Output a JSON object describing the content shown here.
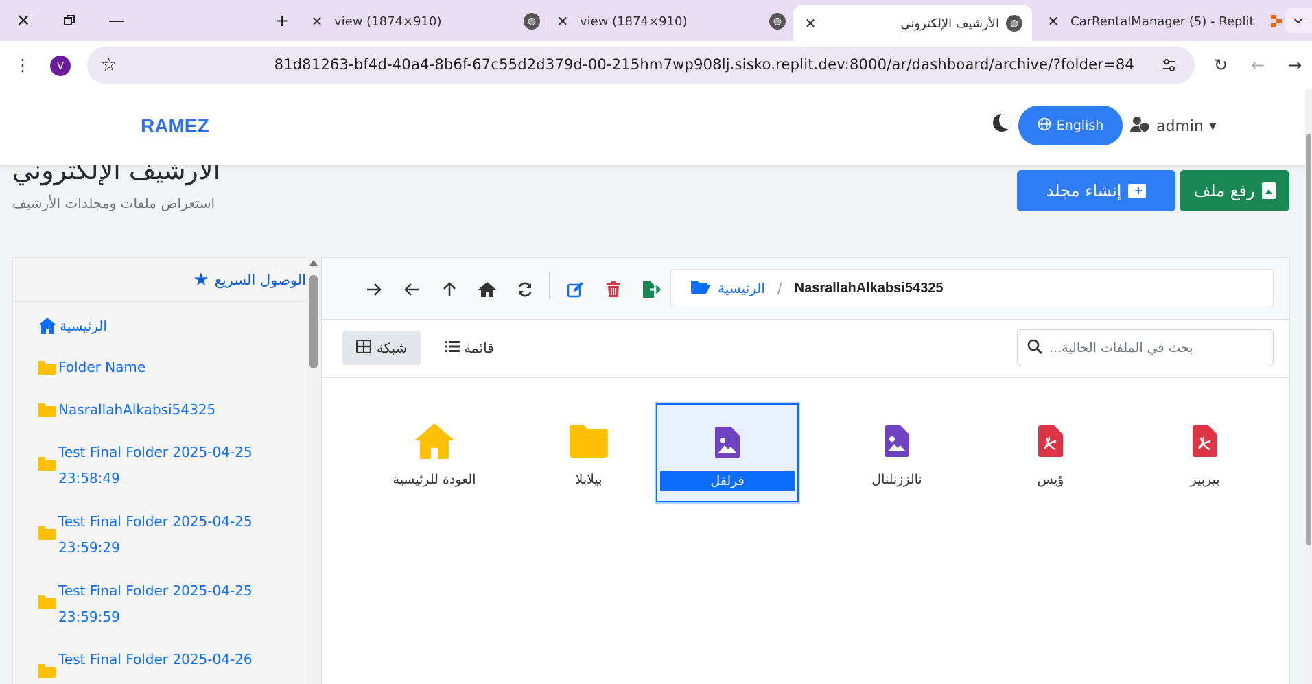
{
  "browser": {
    "tabs": [
      {
        "title": "view (1874×910)"
      },
      {
        "title": "view (1874×910)"
      },
      {
        "title": "الأرشيف الإلكتروني"
      },
      {
        "title": "CarRentalManager (5) - Replit"
      }
    ],
    "avatar_letter": "V",
    "url": "81d81263-bf4d-40a4-8b6f-67c55d2d379d-00-215hm7wp908lj.sisko.replit.dev:8000/ar/dashboard/archive/?folder=84"
  },
  "navbar": {
    "brand": "RAMEZ",
    "lang_label": "English",
    "user_label": "admin"
  },
  "header": {
    "title": "الأرشيف الإلكتروني",
    "subtitle": "استعراض ملفات ومجلدات الأرشيف",
    "upload_label": "رفع ملف",
    "create_folder_label": "إنشاء مجلد"
  },
  "sidebar": {
    "title": "الوصول السريع",
    "items": [
      {
        "label": "الرئيسية"
      },
      {
        "label": "Folder Name"
      },
      {
        "label": "NasrallahAlkabsi54325"
      },
      {
        "label": "Test Final Folder 2025-04-25",
        "label2": "23:58:49"
      },
      {
        "label": "Test Final Folder 2025-04-25",
        "label2": "23:59:29"
      },
      {
        "label": "Test Final Folder 2025-04-25",
        "label2": "23:59:59"
      },
      {
        "label": "Test Final Folder 2025-04-26"
      }
    ]
  },
  "breadcrumb": {
    "home": "الرئيسية",
    "current": "NasrallahAlkabsi54325"
  },
  "view": {
    "grid_label": "شبكة",
    "list_label": "قائمة",
    "search_placeholder": "بحث في الملفات الحالية..."
  },
  "items": [
    {
      "name": "العودة للرئيسية",
      "icon": "home-icon"
    },
    {
      "name": "بيلابلا",
      "icon": "folder-icon"
    },
    {
      "name": "قرلقل",
      "icon": "image-file-icon"
    },
    {
      "name": "نالززنلنال",
      "icon": "image-file-icon"
    },
    {
      "name": "ؤيس",
      "icon": "pdf-file-icon"
    },
    {
      "name": "بيربير",
      "icon": "pdf-file-icon"
    }
  ],
  "colors": {
    "primary": "#2f7df6",
    "success": "#198754",
    "danger": "#dc3545",
    "folder": "#ffc107",
    "image_file": "#6f42c1",
    "pdf_file": "#dc3545"
  }
}
